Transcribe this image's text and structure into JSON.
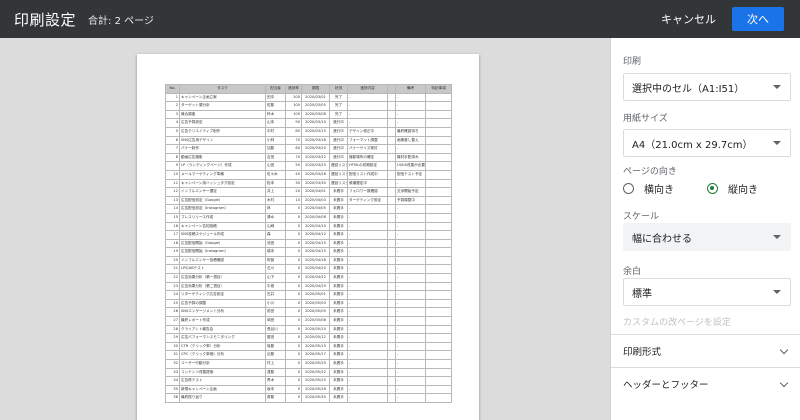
{
  "header": {
    "title": "印刷設定",
    "page_count": "合計: 2 ページ",
    "cancel_label": "キャンセル",
    "next_label": "次へ",
    "accent_color": "#1a73e8"
  },
  "sheet": {
    "headers": [
      "No.",
      "タスク",
      "担当者",
      "進捗率",
      "期限",
      "状況",
      "進捗内容",
      "",
      "備考",
      "特記事項"
    ],
    "rows": [
      [
        "1",
        "キャンペーン企画立案",
        "田中",
        "100",
        "2020/03/01",
        "完了",
        "-",
        "",
        "-",
        ""
      ],
      [
        "2",
        "ターゲット層分析",
        "佐藤",
        "100",
        "2020/03/05",
        "完了",
        "-",
        "",
        "-",
        ""
      ],
      [
        "3",
        "競合調査",
        "鈴木",
        "100",
        "2020/03/08",
        "完了",
        "-",
        "",
        "-",
        ""
      ],
      [
        "4",
        "広告予算設定",
        "山本",
        "90",
        "2020/03/10",
        "進行中",
        "-",
        "",
        "-",
        ""
      ],
      [
        "5",
        "広告クリエイティブ制作",
        "中村",
        "80",
        "2020/03/15",
        "進行中",
        "デザイン修正中",
        "",
        "最終確認待ち",
        ""
      ],
      [
        "6",
        "SNS広告用デザイン",
        "小林",
        "70",
        "2020/03/18",
        "進行中",
        "フォーマット調整",
        "",
        "画像差し替え",
        ""
      ],
      [
        "7",
        "バナー制作",
        "加藤",
        "60",
        "2020/03/20",
        "進行中",
        "バナーサイズ検討",
        "",
        "-",
        ""
      ],
      [
        "8",
        "動画広告撮影",
        "吉田",
        "70",
        "2020/03/22",
        "進行中",
        "撮影場所の確定",
        "",
        "機材手配済み",
        ""
      ],
      [
        "9",
        "LP（ランディングページ）作成",
        "山田",
        "50",
        "2020/03/25",
        "遅延リスク",
        "HTMLの初期設定",
        "",
        "UI/UX改善が必要",
        ""
      ],
      [
        "10",
        "メールマーケティング準備",
        "佐々木",
        "40",
        "2020/03/28",
        "遅延リスク",
        "配信リスト作成中",
        "",
        "配信テスト予定",
        ""
      ],
      [
        "11",
        "キャンペーン用ハッシュタグ設定",
        "松本",
        "30",
        "2020/03/30",
        "遅延リスク",
        "候補選定中",
        "",
        "-",
        ""
      ],
      [
        "12",
        "インフルエンサー選定",
        "井上",
        "20",
        "2020/04/01",
        "未着手",
        "フォロワー数確認",
        "",
        "交渉開始予定",
        ""
      ],
      [
        "13",
        "広告配信設定（Google）",
        "木村",
        "10",
        "2020/04/03",
        "未着手",
        "ターゲティング設定",
        "",
        "予算調整中",
        ""
      ],
      [
        "14",
        "広告配信設定（Instagram）",
        "林",
        "0",
        "2020/04/05",
        "未着手",
        "-",
        "",
        "-",
        ""
      ],
      [
        "15",
        "プレスリリース作成",
        "清水",
        "0",
        "2020/04/08",
        "未着手",
        "-",
        "",
        "-",
        ""
      ],
      [
        "16",
        "キャンペーン告知投稿",
        "山崎",
        "0",
        "2020/04/10",
        "未着手",
        "-",
        "",
        "-",
        ""
      ],
      [
        "17",
        "SNS投稿スケジュール作成",
        "森",
        "0",
        "2020/04/12",
        "未着手",
        "-",
        "",
        "-",
        ""
      ],
      [
        "18",
        "広告配信開始（Google）",
        "池田",
        "0",
        "2020/04/15",
        "未着手",
        "-",
        "",
        "-",
        ""
      ],
      [
        "19",
        "広告配信開始（Instagram）",
        "橋本",
        "0",
        "2020/04/15",
        "未着手",
        "-",
        "",
        "-",
        ""
      ],
      [
        "20",
        "インフルエンサー投稿確認",
        "阿部",
        "0",
        "2020/04/18",
        "未着手",
        "-",
        "",
        "-",
        ""
      ],
      [
        "21",
        "LPのABテスト",
        "石川",
        "0",
        "2020/04/20",
        "未着手",
        "-",
        "",
        "-",
        ""
      ],
      [
        "22",
        "広告効果分析（第一週目）",
        "山下",
        "0",
        "2020/04/22",
        "未着手",
        "-",
        "",
        "-",
        ""
      ],
      [
        "23",
        "広告効果分析（第二週目）",
        "中島",
        "0",
        "2020/04/29",
        "未着手",
        "-",
        "",
        "-",
        ""
      ],
      [
        "24",
        "リターゲティング広告設定",
        "石井",
        "0",
        "2020/05/01",
        "未着手",
        "-",
        "",
        "-",
        ""
      ],
      [
        "25",
        "広告予算の調整",
        "小川",
        "0",
        "2020/05/03",
        "未着手",
        "-",
        "",
        "-",
        ""
      ],
      [
        "26",
        "SNSエンゲージメント分析",
        "前田",
        "0",
        "2020/05/05",
        "未着手",
        "-",
        "",
        "-",
        ""
      ],
      [
        "27",
        "最終レポート作成",
        "岡田",
        "0",
        "2020/05/08",
        "未着手",
        "-",
        "",
        "-",
        ""
      ],
      [
        "28",
        "クライアント報告会",
        "長谷川",
        "0",
        "2020/05/10",
        "未着手",
        "-",
        "",
        "-",
        ""
      ],
      [
        "29",
        "広告パフォーマンスモニタリング",
        "藤田",
        "0",
        "2020/05/12",
        "未着手",
        "-",
        "",
        "-",
        ""
      ],
      [
        "30",
        "CTR（クリック率）分析",
        "後藤",
        "0",
        "2020/05/15",
        "未着手",
        "-",
        "",
        "-",
        ""
      ],
      [
        "31",
        "CPC（クリック単価）分析",
        "近藤",
        "0",
        "2020/05/17",
        "未着手",
        "-",
        "",
        "-",
        ""
      ],
      [
        "32",
        "ユーザー行動分析",
        "村上",
        "0",
        "2020/05/20",
        "未着手",
        "-",
        "",
        "-",
        ""
      ],
      [
        "33",
        "コンテンツ改善提案",
        "遠藤",
        "0",
        "2020/05/22",
        "未着手",
        "-",
        "",
        "-",
        ""
      ],
      [
        "34",
        "広告再テスト",
        "青木",
        "0",
        "2020/05/25",
        "未着手",
        "-",
        "",
        "-",
        ""
      ],
      [
        "35",
        "新規キャンペーン企画",
        "坂本",
        "0",
        "2020/05/28",
        "未着手",
        "-",
        "",
        "-",
        ""
      ],
      [
        "36",
        "最終振り返り",
        "斉藤",
        "0",
        "2020/05/30",
        "未着手",
        "-",
        "",
        "-",
        ""
      ]
    ]
  },
  "settings": {
    "print_label": "印刷",
    "print_value": "選択中のセル（A1:I51）",
    "paper_label": "用紙サイズ",
    "paper_value": "A4（21.0cm x 29.7cm）",
    "orientation_label": "ページの向き",
    "landscape_label": "横向き",
    "portrait_label": "縦向き",
    "orientation_selected": "portrait",
    "scale_label": "スケール",
    "scale_value": "幅に合わせる",
    "margin_label": "余白",
    "margin_value": "標準",
    "custom_page_break": "カスタムの改ページを設定",
    "format_section": "印刷形式",
    "header_footer_section": "ヘッダーとフッター"
  }
}
